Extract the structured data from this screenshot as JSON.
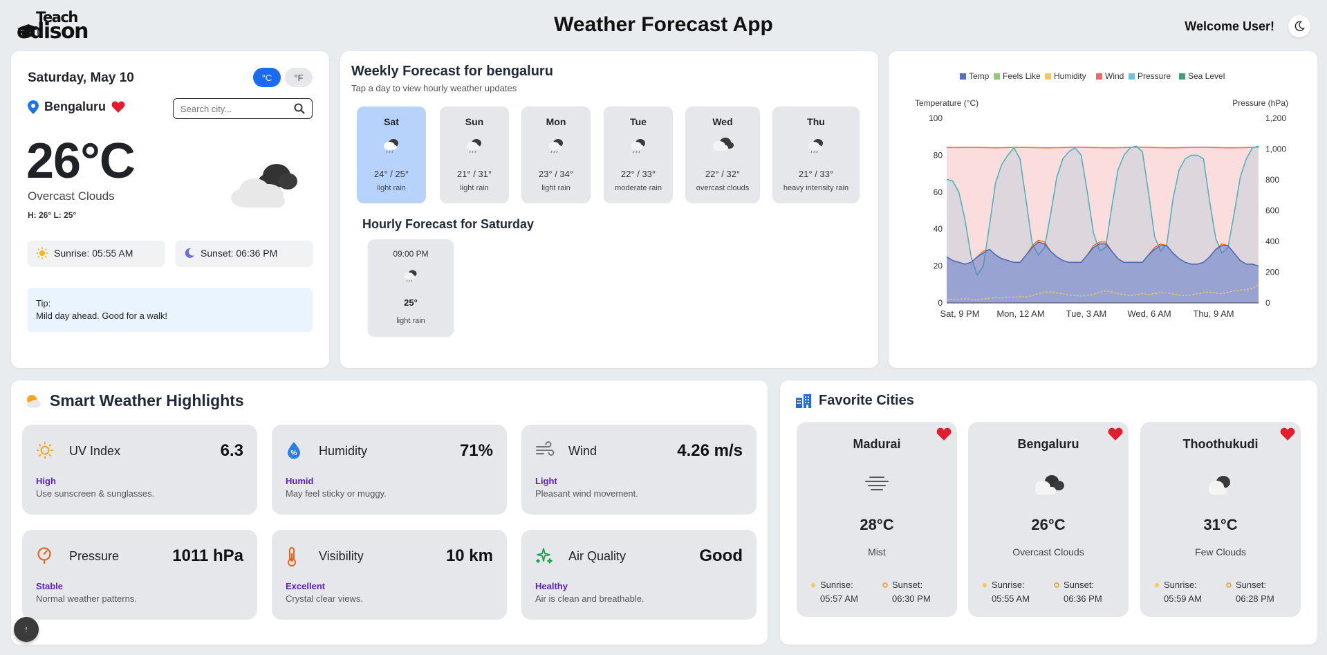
{
  "app": {
    "title": "Weather Forecast App",
    "welcome": "Welcome User!",
    "logo": "Teach edison"
  },
  "current": {
    "date": "Saturday, May 10",
    "unit_c": "°C",
    "unit_f": "°F",
    "city": "Bengaluru",
    "search_placeholder": "Search city...",
    "temp": "26°C",
    "condition": "Overcast Clouds",
    "hilo": "H: 26° L: 25°",
    "sunrise": "Sunrise: 05:55 AM",
    "sunset": "Sunset: 06:36 PM",
    "tip_label": "Tip:",
    "tip_text": "Mild day ahead. Good for a walk!"
  },
  "weekly": {
    "title": "Weekly Forecast for bengaluru",
    "subtitle": "Tap a day to view hourly weather updates",
    "days": [
      {
        "name": "Sat",
        "temps": "24° / 25°",
        "desc": "light rain",
        "icon": "rain-icon"
      },
      {
        "name": "Sun",
        "temps": "21° / 31°",
        "desc": "light rain",
        "icon": "rain-icon"
      },
      {
        "name": "Mon",
        "temps": "23° / 34°",
        "desc": "light rain",
        "icon": "rain-icon"
      },
      {
        "name": "Tue",
        "temps": "22° / 33°",
        "desc": "moderate rain",
        "icon": "rain-icon"
      },
      {
        "name": "Wed",
        "temps": "22° / 32°",
        "desc": "overcast clouds",
        "icon": "cloud-icon"
      },
      {
        "name": "Thu",
        "temps": "21° / 33°",
        "desc": "heavy intensity rain",
        "icon": "rain-icon"
      }
    ],
    "hourly_title": "Hourly Forecast for Saturday",
    "hourly": [
      {
        "time": "09:00 PM",
        "temp": "25°",
        "desc": "light rain"
      }
    ]
  },
  "chart_data": {
    "type": "area",
    "legend": [
      "Temp",
      "Feels Like",
      "Humidity",
      "Wind",
      "Pressure",
      "Sea Level"
    ],
    "colors": {
      "Temp": "#5470c6",
      "Feels Like": "#91cc75",
      "Humidity": "#fac858",
      "Wind": "#ee6666",
      "Pressure": "#73c0de",
      "Sea Level": "#3ba272"
    },
    "ylabel_left": "Temperature (°C)",
    "ylabel_right": "Pressure (hPa)",
    "ylim_left": [
      0,
      100
    ],
    "ylim_right": [
      0,
      1200
    ],
    "yticks_left": [
      "0",
      "20",
      "40",
      "60",
      "80",
      "100"
    ],
    "yticks_right": [
      "0",
      "200",
      "400",
      "600",
      "800",
      "1,000",
      "1,200"
    ],
    "xticks": [
      "Sat, 9 PM",
      "Mon, 12 AM",
      "Tue, 3 AM",
      "Wed, 6 AM",
      "Thu, 9 AM"
    ],
    "legend_position": "top",
    "temp": [
      25,
      23,
      22,
      21,
      22,
      25,
      27,
      29,
      26,
      24,
      23,
      22,
      22,
      26,
      30,
      33,
      32,
      28,
      25,
      23,
      22,
      22,
      22,
      26,
      30,
      32,
      32,
      28,
      24,
      22,
      22,
      22,
      22,
      26,
      29,
      31,
      31,
      27,
      24,
      22,
      21,
      21,
      22,
      25,
      29,
      31,
      31,
      27,
      23,
      21,
      21,
      20
    ],
    "feels_like": [
      25,
      23,
      22,
      21,
      22,
      25,
      28,
      29,
      26,
      24,
      23,
      22,
      22,
      26,
      31,
      34,
      33,
      28,
      25,
      23,
      22,
      22,
      22,
      26,
      31,
      33,
      33,
      28,
      24,
      22,
      22,
      22,
      22,
      26,
      30,
      32,
      31,
      27,
      24,
      22,
      21,
      21,
      22,
      25,
      29,
      32,
      31,
      27,
      23,
      21,
      21,
      20
    ],
    "humidity": [
      2.0,
      2.1,
      1.9,
      2.3,
      2.0,
      1.8,
      2.2,
      2.5,
      3.0,
      2.6,
      3.1,
      2.9,
      3.5,
      3.2,
      4.0,
      5.1,
      5.8,
      6.0,
      5.5,
      4.9,
      4.2,
      4.0,
      3.8,
      4.1,
      4.6,
      5.8,
      6.5,
      5.9,
      5.0,
      4.6,
      4.0,
      4.4,
      5.0,
      4.6,
      5.1,
      5.8,
      5.4,
      4.9,
      4.3,
      4.0,
      4.4,
      5.0,
      5.6,
      5.9,
      5.3,
      5.0,
      5.8,
      6.5,
      7.0,
      7.2,
      8.0,
      9.8
    ],
    "wind": [
      1010,
      1010,
      1010,
      1011,
      1011,
      1011,
      1010,
      1009,
      1008,
      1009,
      1010,
      1011,
      1011,
      1011,
      1010,
      1009,
      1008,
      1008,
      1009,
      1010,
      1011,
      1012,
      1012,
      1011,
      1010,
      1009,
      1008,
      1008,
      1009,
      1010,
      1011,
      1012,
      1012,
      1011,
      1010,
      1009,
      1008,
      1008,
      1009,
      1010,
      1011,
      1012,
      1012,
      1011,
      1010,
      1009,
      1008,
      1008,
      1009,
      1010,
      1011,
      1012
    ],
    "pressure": [
      67,
      66,
      60,
      45,
      25,
      15,
      20,
      42,
      65,
      75,
      80,
      84,
      78,
      55,
      32,
      26,
      30,
      48,
      68,
      78,
      82,
      84,
      80,
      60,
      38,
      28,
      30,
      52,
      72,
      80,
      84,
      85,
      82,
      60,
      36,
      28,
      32,
      56,
      72,
      78,
      80,
      80,
      78,
      55,
      35,
      27,
      30,
      48,
      68,
      78,
      84,
      85
    ]
  },
  "highlights": {
    "title": "Smart Weather Highlights",
    "tiles": [
      {
        "label": "UV Index",
        "value": "6.3",
        "status": "High",
        "desc": "Use sunscreen & sunglasses.",
        "icon": "sun-icon"
      },
      {
        "label": "Humidity",
        "value": "71%",
        "status": "Humid",
        "desc": "May feel sticky or muggy.",
        "icon": "droplet-percent-icon"
      },
      {
        "label": "Wind",
        "value": "4.26 m/s",
        "status": "Light",
        "desc": "Pleasant wind movement.",
        "icon": "wind-icon"
      },
      {
        "label": "Pressure",
        "value": "1011 hPa",
        "status": "Stable",
        "desc": "Normal weather patterns.",
        "icon": "gauge-icon"
      },
      {
        "label": "Visibility",
        "value": "10 km",
        "status": "Excellent",
        "desc": "Crystal clear views.",
        "icon": "thermometer-icon"
      },
      {
        "label": "Air Quality",
        "value": "Good",
        "status": "Healthy",
        "desc": "Air is clean and breathable.",
        "icon": "sparkles-icon"
      }
    ]
  },
  "favorites": {
    "title": "Favorite Cities",
    "cities": [
      {
        "city": "Madurai",
        "temp": "28°C",
        "cond": "Mist",
        "sunrise_label": "Sunrise:",
        "sunrise": "05:57 AM",
        "sunset_label": "Sunset:",
        "sunset": "06:30 PM",
        "icon": "mist-icon"
      },
      {
        "city": "Bengaluru",
        "temp": "26°C",
        "cond": "Overcast Clouds",
        "sunrise_label": "Sunrise:",
        "sunrise": "05:55 AM",
        "sunset_label": "Sunset:",
        "sunset": "06:36 PM",
        "icon": "overcast-cloud-icon"
      },
      {
        "city": "Thoothukudi",
        "temp": "31°C",
        "cond": "Few Clouds",
        "sunrise_label": "Sunrise:",
        "sunrise": "05:59 AM",
        "sunset_label": "Sunset:",
        "sunset": "06:28 PM",
        "icon": "few-clouds-icon"
      }
    ]
  },
  "float_button": {
    "label": "!"
  }
}
